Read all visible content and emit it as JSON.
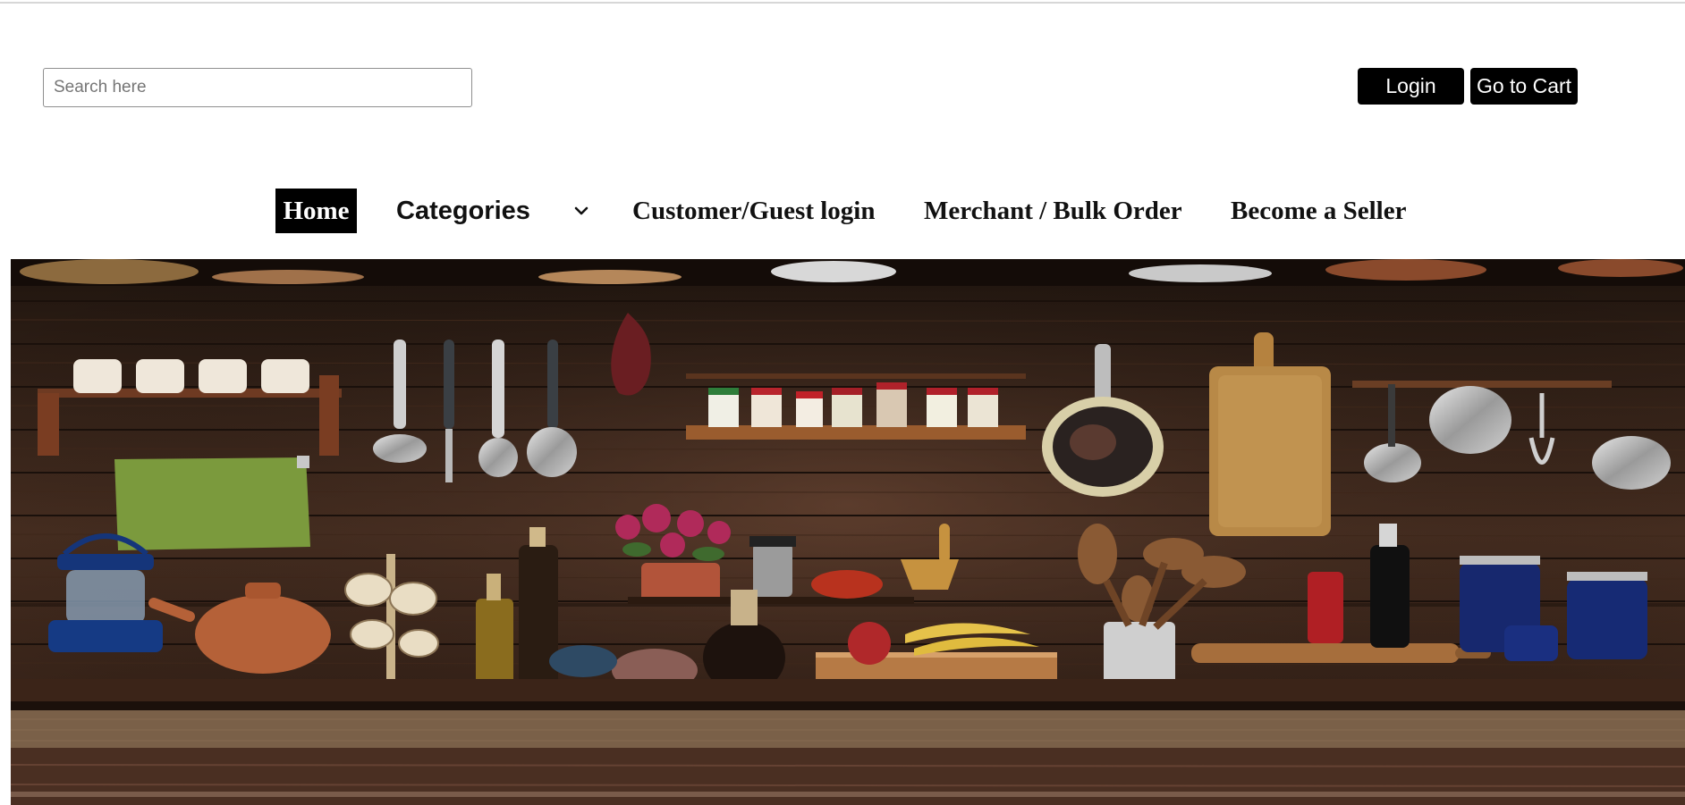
{
  "search": {
    "placeholder": "Search here",
    "value": ""
  },
  "header": {
    "login_label": "Login",
    "cart_label": "Go to Cart"
  },
  "nav": {
    "home": "Home",
    "categories": "Categories",
    "customer": "Customer/Guest login",
    "merchant": "Merchant / Bulk Order",
    "seller": "Become a Seller",
    "active": "Home",
    "categories_icon": "chevron-down-icon"
  },
  "colors": {
    "button_bg": "#000000",
    "button_text": "#ffffff",
    "active_nav_bg": "#000000"
  }
}
